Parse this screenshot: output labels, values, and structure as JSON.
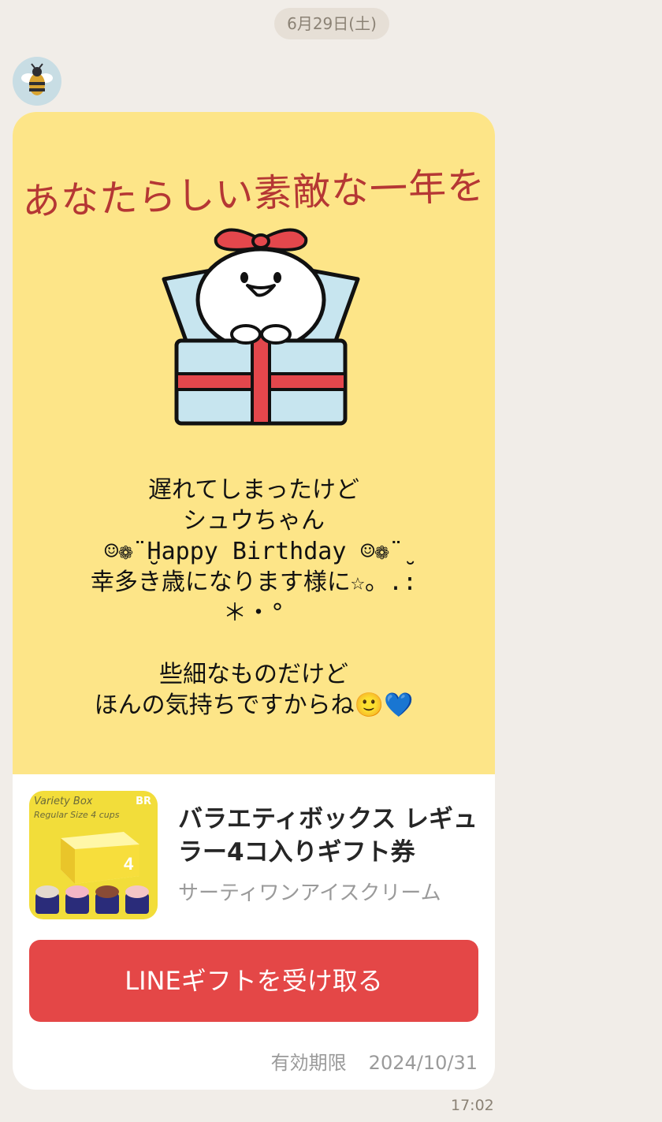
{
  "date_label": "6月29日(土)",
  "message_card": {
    "headline": "あなたらしい素敵な一年を",
    "message_lines": [
      "遅れてしまったけど",
      "シュウちゃん",
      "☺︎❁¨̮Happy Birthday ☺︎❁¨̮",
      "幸多き歳になります様に☆。.:",
      "＊・°",
      "",
      "些細なものだけど",
      "ほんの気持ちですからね🙂💙"
    ]
  },
  "gift": {
    "thumbnail": {
      "title": "Variety Box",
      "subtitle": "Regular Size 4 cups",
      "logo": "BR"
    },
    "product_name": "バラエティボックス レギュラー4コ入りギフト券",
    "brand": "サーティワンアイスクリーム",
    "receive_button": "LINEギフトを受け取る",
    "validity_label": "有効期限",
    "validity_date": "2024/10/31"
  },
  "timestamp": "17:02",
  "colors": {
    "background": "#f1ede8",
    "card_top": "#fde588",
    "button": "#e44747",
    "headline": "#b53734"
  },
  "icons": {
    "avatar": "bee-avatar-icon",
    "gift_art": "gift-box-bird-illustration"
  }
}
